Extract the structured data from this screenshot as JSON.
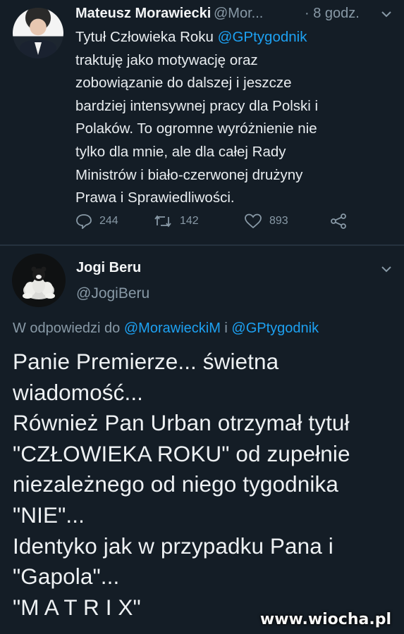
{
  "tweet": {
    "author_name": "Mateusz Morawiecki",
    "author_handle": "@Mor...",
    "time": "· 8 godz.",
    "lines": [
      [
        {
          "t": "Tytuł Człowieka Roku "
        },
        {
          "t": "@GPtygodnik",
          "m": true
        }
      ],
      [
        {
          "t": "traktuję jako motywację oraz"
        }
      ],
      [
        {
          "t": "zobowiązanie do dalszej i jeszcze"
        }
      ],
      [
        {
          "t": "bardziej intensywnej pracy dla Polski i"
        }
      ],
      [
        {
          "t": "Polaków. To ogromne wyróżnienie nie"
        }
      ],
      [
        {
          "t": "tylko dla mnie, ale dla całej Rady"
        }
      ],
      [
        {
          "t": "Ministrów i biało-czerwonej drużyny"
        }
      ],
      [
        {
          "t": "Prawa i Sprawiedliwości."
        }
      ]
    ],
    "replies": "244",
    "retweets": "142",
    "likes": "893"
  },
  "reply": {
    "author_name": "Jogi Beru",
    "author_handle": "@JogiBeru",
    "replying_prefix": "W odpowiedzi do ",
    "replying_to_1": "@MorawieckiM",
    "replying_and": " i ",
    "replying_to_2": "@GPtygodnik",
    "lines": [
      "Panie Premierze... świetna",
      "wiadomość...",
      "Również Pan Urban otrzymał tytuł",
      "\"CZŁOWIEKA ROKU\" od zupełnie",
      "niezależnego od niego tygodnika",
      "\"NIE\"...",
      "Identyko jak w przypadku Pana i",
      "\"Gapola\"...",
      "\"M A T R I X\""
    ]
  },
  "watermark": "www.wiocha.pl",
  "colors": {
    "background": "#141d26",
    "mention": "#1da1f2",
    "secondary": "#8899a6"
  }
}
